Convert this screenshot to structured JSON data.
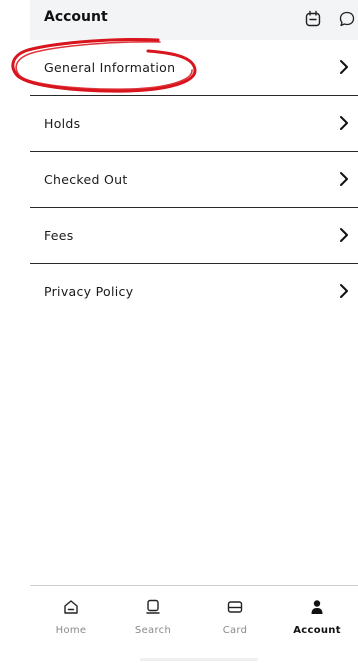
{
  "header": {
    "title": "Account",
    "icons": [
      "calendar-icon",
      "chat-bubble-icon"
    ]
  },
  "menu": {
    "items": [
      {
        "label": "General Information"
      },
      {
        "label": "Holds"
      },
      {
        "label": "Checked Out"
      },
      {
        "label": "Fees"
      },
      {
        "label": "Privacy Policy"
      }
    ]
  },
  "tabbar": {
    "tabs": [
      {
        "label": "Home",
        "icon": "home-icon"
      },
      {
        "label": "Search",
        "icon": "search-icon"
      },
      {
        "label": "Card",
        "icon": "card-icon"
      },
      {
        "label": "Account",
        "icon": "person-icon",
        "active": true
      }
    ]
  },
  "colors": {
    "annotation": "#d8141c",
    "header_bg": "#f3f4f5",
    "divider": "#2b2b2b"
  }
}
